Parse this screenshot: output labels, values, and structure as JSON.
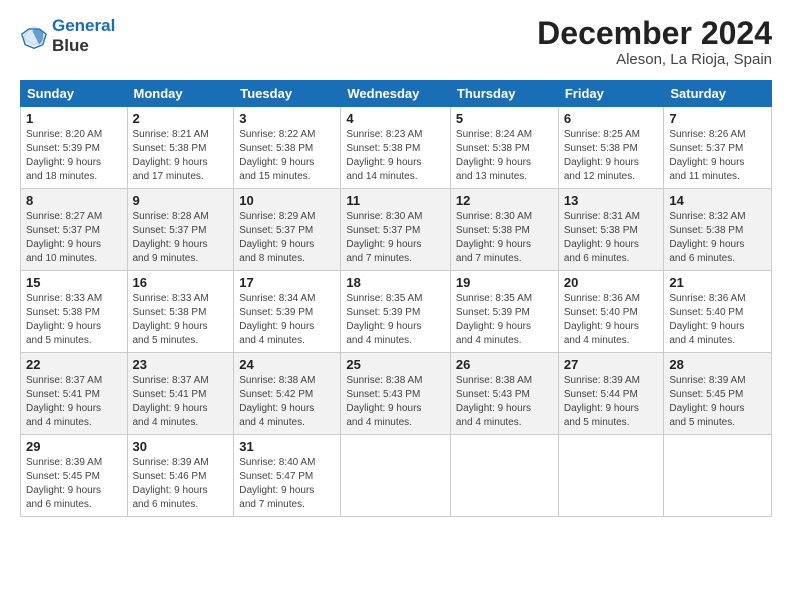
{
  "logo": {
    "line1": "General",
    "line2": "Blue"
  },
  "title": "December 2024",
  "location": "Aleson, La Rioja, Spain",
  "days_of_week": [
    "Sunday",
    "Monday",
    "Tuesday",
    "Wednesday",
    "Thursday",
    "Friday",
    "Saturday"
  ],
  "weeks": [
    [
      {
        "day": "1",
        "info": "Sunrise: 8:20 AM\nSunset: 5:39 PM\nDaylight: 9 hours\nand 18 minutes."
      },
      {
        "day": "2",
        "info": "Sunrise: 8:21 AM\nSunset: 5:38 PM\nDaylight: 9 hours\nand 17 minutes."
      },
      {
        "day": "3",
        "info": "Sunrise: 8:22 AM\nSunset: 5:38 PM\nDaylight: 9 hours\nand 15 minutes."
      },
      {
        "day": "4",
        "info": "Sunrise: 8:23 AM\nSunset: 5:38 PM\nDaylight: 9 hours\nand 14 minutes."
      },
      {
        "day": "5",
        "info": "Sunrise: 8:24 AM\nSunset: 5:38 PM\nDaylight: 9 hours\nand 13 minutes."
      },
      {
        "day": "6",
        "info": "Sunrise: 8:25 AM\nSunset: 5:38 PM\nDaylight: 9 hours\nand 12 minutes."
      },
      {
        "day": "7",
        "info": "Sunrise: 8:26 AM\nSunset: 5:37 PM\nDaylight: 9 hours\nand 11 minutes."
      }
    ],
    [
      {
        "day": "8",
        "info": "Sunrise: 8:27 AM\nSunset: 5:37 PM\nDaylight: 9 hours\nand 10 minutes."
      },
      {
        "day": "9",
        "info": "Sunrise: 8:28 AM\nSunset: 5:37 PM\nDaylight: 9 hours\nand 9 minutes."
      },
      {
        "day": "10",
        "info": "Sunrise: 8:29 AM\nSunset: 5:37 PM\nDaylight: 9 hours\nand 8 minutes."
      },
      {
        "day": "11",
        "info": "Sunrise: 8:30 AM\nSunset: 5:37 PM\nDaylight: 9 hours\nand 7 minutes."
      },
      {
        "day": "12",
        "info": "Sunrise: 8:30 AM\nSunset: 5:38 PM\nDaylight: 9 hours\nand 7 minutes."
      },
      {
        "day": "13",
        "info": "Sunrise: 8:31 AM\nSunset: 5:38 PM\nDaylight: 9 hours\nand 6 minutes."
      },
      {
        "day": "14",
        "info": "Sunrise: 8:32 AM\nSunset: 5:38 PM\nDaylight: 9 hours\nand 6 minutes."
      }
    ],
    [
      {
        "day": "15",
        "info": "Sunrise: 8:33 AM\nSunset: 5:38 PM\nDaylight: 9 hours\nand 5 minutes."
      },
      {
        "day": "16",
        "info": "Sunrise: 8:33 AM\nSunset: 5:38 PM\nDaylight: 9 hours\nand 5 minutes."
      },
      {
        "day": "17",
        "info": "Sunrise: 8:34 AM\nSunset: 5:39 PM\nDaylight: 9 hours\nand 4 minutes."
      },
      {
        "day": "18",
        "info": "Sunrise: 8:35 AM\nSunset: 5:39 PM\nDaylight: 9 hours\nand 4 minutes."
      },
      {
        "day": "19",
        "info": "Sunrise: 8:35 AM\nSunset: 5:39 PM\nDaylight: 9 hours\nand 4 minutes."
      },
      {
        "day": "20",
        "info": "Sunrise: 8:36 AM\nSunset: 5:40 PM\nDaylight: 9 hours\nand 4 minutes."
      },
      {
        "day": "21",
        "info": "Sunrise: 8:36 AM\nSunset: 5:40 PM\nDaylight: 9 hours\nand 4 minutes."
      }
    ],
    [
      {
        "day": "22",
        "info": "Sunrise: 8:37 AM\nSunset: 5:41 PM\nDaylight: 9 hours\nand 4 minutes."
      },
      {
        "day": "23",
        "info": "Sunrise: 8:37 AM\nSunset: 5:41 PM\nDaylight: 9 hours\nand 4 minutes."
      },
      {
        "day": "24",
        "info": "Sunrise: 8:38 AM\nSunset: 5:42 PM\nDaylight: 9 hours\nand 4 minutes."
      },
      {
        "day": "25",
        "info": "Sunrise: 8:38 AM\nSunset: 5:43 PM\nDaylight: 9 hours\nand 4 minutes."
      },
      {
        "day": "26",
        "info": "Sunrise: 8:38 AM\nSunset: 5:43 PM\nDaylight: 9 hours\nand 4 minutes."
      },
      {
        "day": "27",
        "info": "Sunrise: 8:39 AM\nSunset: 5:44 PM\nDaylight: 9 hours\nand 5 minutes."
      },
      {
        "day": "28",
        "info": "Sunrise: 8:39 AM\nSunset: 5:45 PM\nDaylight: 9 hours\nand 5 minutes."
      }
    ],
    [
      {
        "day": "29",
        "info": "Sunrise: 8:39 AM\nSunset: 5:45 PM\nDaylight: 9 hours\nand 6 minutes."
      },
      {
        "day": "30",
        "info": "Sunrise: 8:39 AM\nSunset: 5:46 PM\nDaylight: 9 hours\nand 6 minutes."
      },
      {
        "day": "31",
        "info": "Sunrise: 8:40 AM\nSunset: 5:47 PM\nDaylight: 9 hours\nand 7 minutes."
      },
      null,
      null,
      null,
      null
    ]
  ]
}
